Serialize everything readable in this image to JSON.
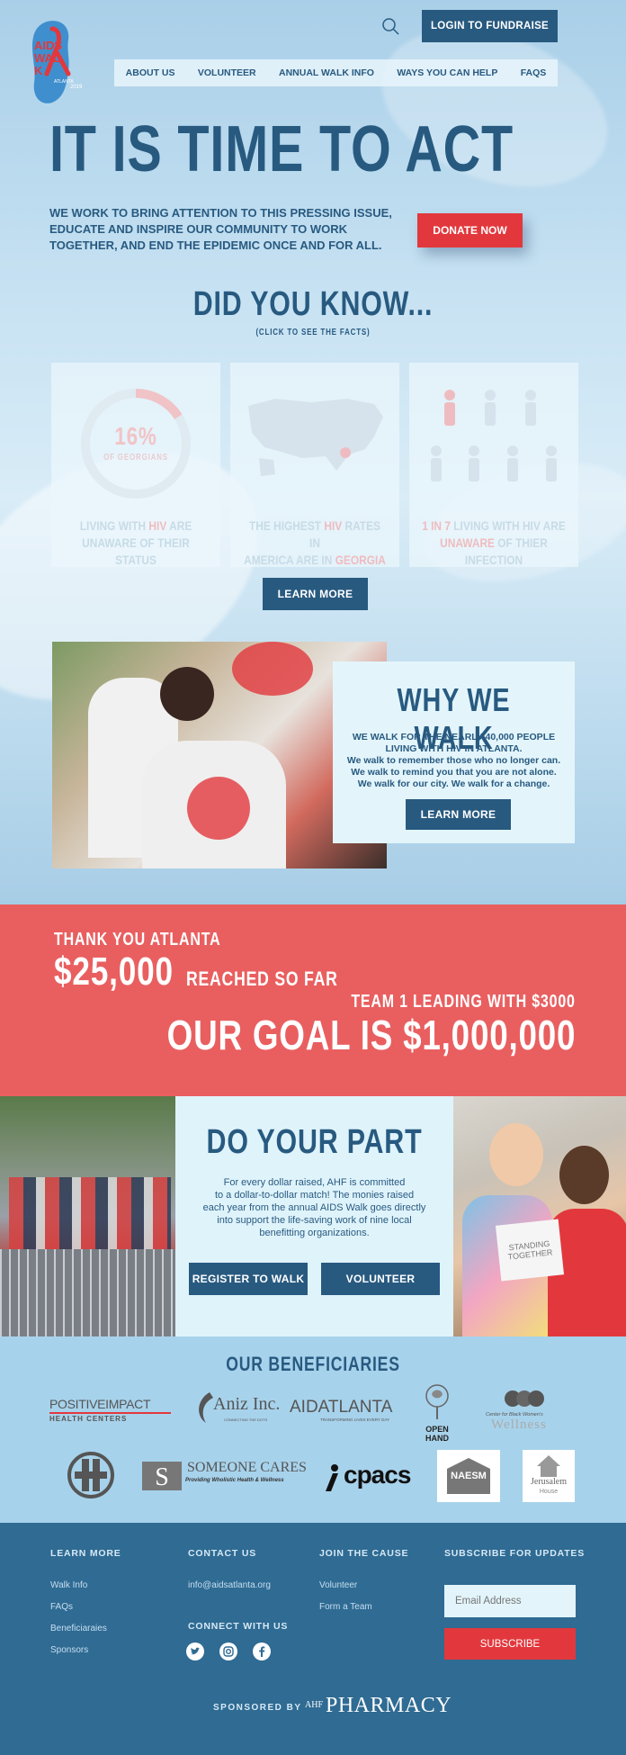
{
  "header": {
    "login_label": "LOGIN TO FUNDRAISE",
    "logo_text": "AIDS WALK",
    "logo_sub": "ATLANTA",
    "logo_year": "2019"
  },
  "nav": {
    "items": [
      {
        "label": "ABOUT US"
      },
      {
        "label": "VOLUNTEER"
      },
      {
        "label": "ANNUAL WALK INFO"
      },
      {
        "label": "WAYS YOU CAN HELP"
      },
      {
        "label": "FAQS"
      }
    ]
  },
  "hero": {
    "title": "IT IS TIME TO ACT",
    "lines": [
      "WE WORK TO BRING ATTENTION TO THIS PRESSING ISSUE,",
      "EDUCATE AND INSPIRE OUR COMMUNITY TO WORK",
      "TOGETHER, AND END THE EPIDEMIC ONCE AND FOR ALL."
    ],
    "donate_label": "DONATE NOW"
  },
  "did_you_know": {
    "title": "DID YOU KNOW...",
    "subtitle": "(CLICK TO SEE THE FACTS)",
    "stat_value": "16%",
    "stat_caption": "OF GEORGIANS",
    "facts": [
      {
        "pre": "LIVING WITH ",
        "hl": "HIV",
        "post": " ARE",
        "line2pre": "UNAWARE OF THEIR STATUS",
        "line2hl": "",
        "line2post": ""
      },
      {
        "pre": "THE HIGHEST ",
        "hl": "HIV",
        "post": " RATES IN",
        "line2pre": "AMERICA ARE IN ",
        "line2hl": "GEORGIA",
        "line2post": ""
      },
      {
        "pre": "",
        "hl": "1 IN 7",
        "post": " LIVING WITH HIV ARE",
        "line2pre": "",
        "line2hl": "UNAWARE",
        "line2post": " OF THIER INFECTION"
      }
    ],
    "learn_more_label": "LEARN MORE"
  },
  "why_we_walk": {
    "title": "WHY WE WALK",
    "lines": [
      "WE WALK FOR THE NEARLY 40,000 PEOPLE",
      "LIVING WITH HIV IN ATLANTA.",
      "We walk to remember those who no longer can.",
      "We walk to remind you that you are not alone.",
      "We walk for our city. We walk for a change."
    ],
    "learn_more_label": "LEARN MORE"
  },
  "progress": {
    "thanks": "THANK YOU ATLANTA",
    "raised": "$25,000",
    "raised_caption": "REACHED SO FAR",
    "leader": "TEAM 1 LEADING WITH $3000",
    "goal": "OUR GOAL IS $1,000,000"
  },
  "do_your_part": {
    "title": "DO YOUR PART",
    "lines": [
      "For every dollar raised, AHF is committed",
      "to a dollar-to-dollar match! The monies raised",
      "each year from the annual AIDS Walk goes directly",
      "into support the life-saving work of nine local",
      "benefitting organizations."
    ],
    "register_label": "REGISTER TO WALK",
    "volunteer_label": "VOLUNTEER",
    "sign_text": "STANDING TOGETHER"
  },
  "beneficiaries": {
    "title": "OUR BENEFICIARIES",
    "logos": [
      {
        "name": "POSITIVEIMPACT",
        "sub": "HEALTH CENTERS"
      },
      {
        "name": "Aniz Inc.",
        "sub": "CONNECTING THE DOTS"
      },
      {
        "name": "AIDATLANTA",
        "sub": "TRANSFORMING LIVES EVERY DAY"
      },
      {
        "name": "OPEN HAND",
        "sub": ""
      },
      {
        "name": "Wellness",
        "sub": "Center for Black Women's"
      },
      {
        "name": "",
        "sub": ""
      },
      {
        "name": "SOMEONE CARES",
        "sub": "Providing Wholistic Health & Wellness"
      },
      {
        "name": "cpacs",
        "sub": ""
      },
      {
        "name": "NAESM",
        "sub": ""
      },
      {
        "name": "Jerusalem",
        "sub": "House"
      }
    ]
  },
  "footer": {
    "learn_more": {
      "heading": "LEARN MORE",
      "links": [
        "Walk Info",
        "FAQs",
        "Beneficiaraies",
        "Sponsors"
      ]
    },
    "contact": {
      "heading": "CONTACT US",
      "email": "info@aidsatlanta.org",
      "connect": "CONNECT WITH US"
    },
    "join": {
      "heading": "JOIN THE CAUSE",
      "links": [
        "Volunteer",
        "Form a Team"
      ]
    },
    "subscribe": {
      "heading": "SUBSCRIBE FOR UPDATES",
      "placeholder": "Email Address",
      "button": "SUBSCRIBE"
    },
    "sponsored_by": "SPONSORED BY",
    "sponsor_prefix": "AHF",
    "sponsor_name": "PHARMACY"
  },
  "colors": {
    "navy": "#285a80",
    "red": "#e2383d",
    "coral": "#e95f60",
    "footer": "#2f6b93"
  }
}
